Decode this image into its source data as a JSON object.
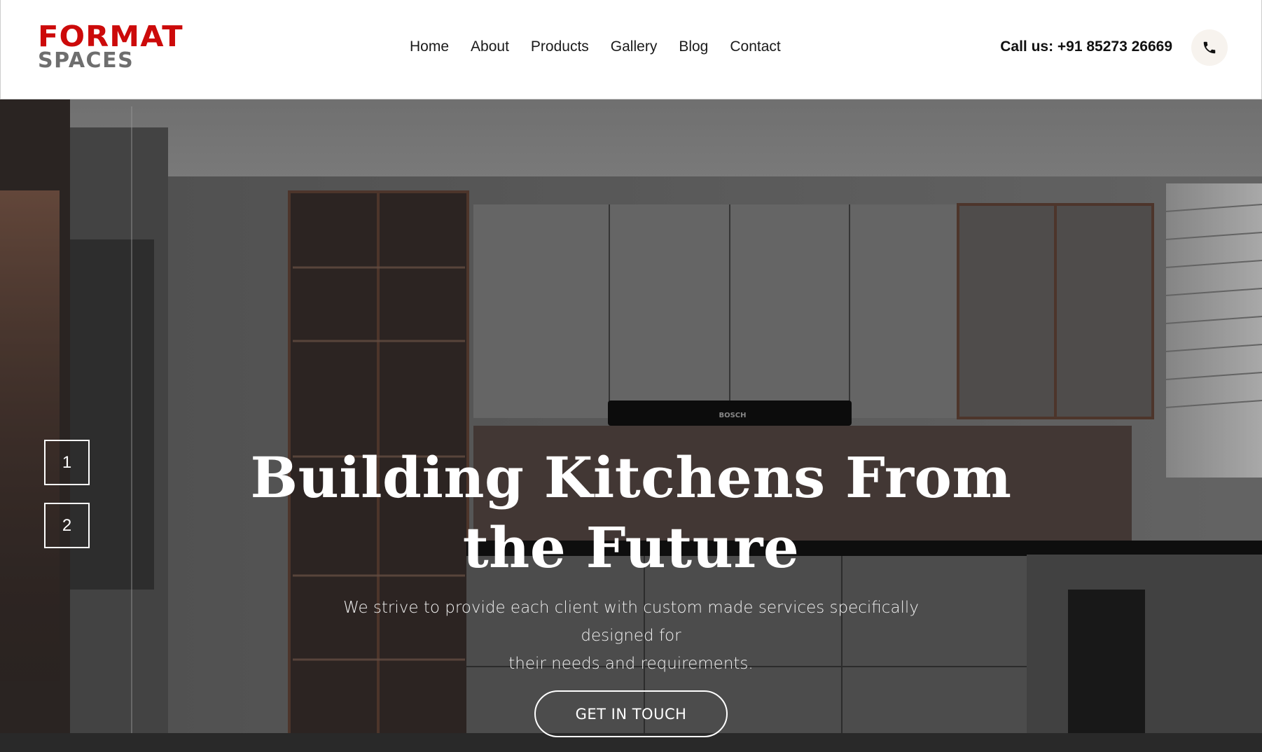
{
  "brand": {
    "line1": "FORMAT",
    "line2": "SPACES",
    "accent": "#cc0a0a",
    "secondary": "#6e6e6e"
  },
  "nav": {
    "items": [
      "Home",
      "About",
      "Products",
      "Gallery",
      "Blog",
      "Contact"
    ]
  },
  "contact": {
    "call_text": "Call us: +91 85273 26669",
    "icon": "phone-icon"
  },
  "slider": {
    "indicators": [
      "1",
      "2"
    ]
  },
  "hero": {
    "title_line1": "Building Kitchens From",
    "title_line2": "the Future",
    "subtitle_line1": "We strive to provide each client with custom made services specifically designed for",
    "subtitle_line2": "their needs and requirements.",
    "cta_label": "GET IN TOUCH",
    "hood_brand": "BOSCH"
  }
}
